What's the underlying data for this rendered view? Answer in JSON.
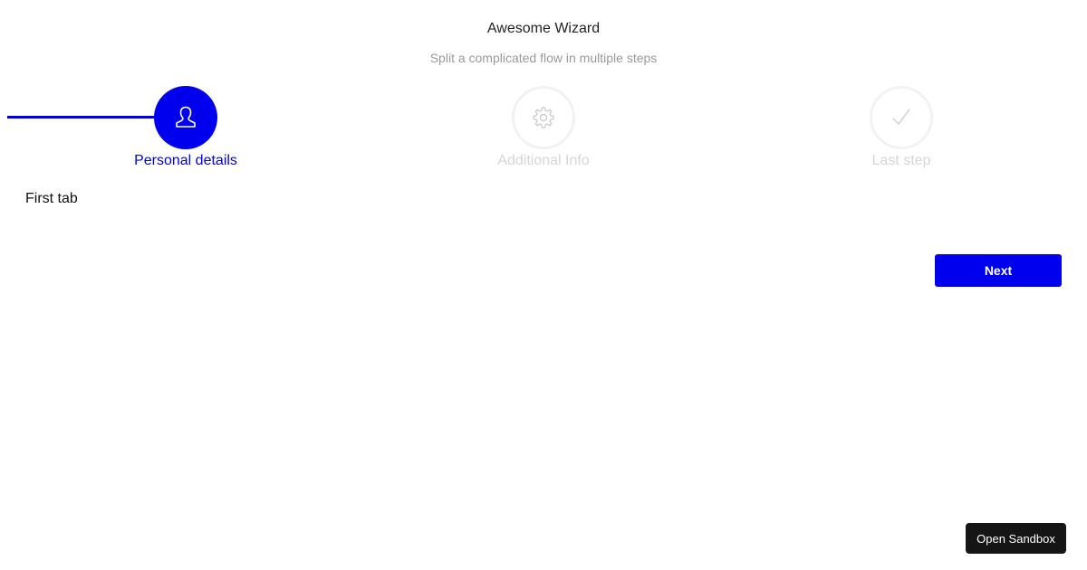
{
  "wizard": {
    "title": "Awesome Wizard",
    "subtitle": "Split a complicated flow in multiple steps"
  },
  "steps": [
    {
      "label": "Personal details",
      "icon": "user-icon",
      "state": "active"
    },
    {
      "label": "Additional Info",
      "icon": "gear-icon",
      "state": "inactive"
    },
    {
      "label": "Last step",
      "icon": "check-icon",
      "state": "inactive"
    }
  ],
  "progress": {
    "current_step": 1,
    "total_steps": 3
  },
  "tab": {
    "content": "First tab"
  },
  "buttons": {
    "next": "Next",
    "open_sandbox": "Open Sandbox"
  },
  "colors": {
    "accent": "#0000ee",
    "inactive_border": "#f2f2f2",
    "inactive_text": "#d6d6d6"
  }
}
